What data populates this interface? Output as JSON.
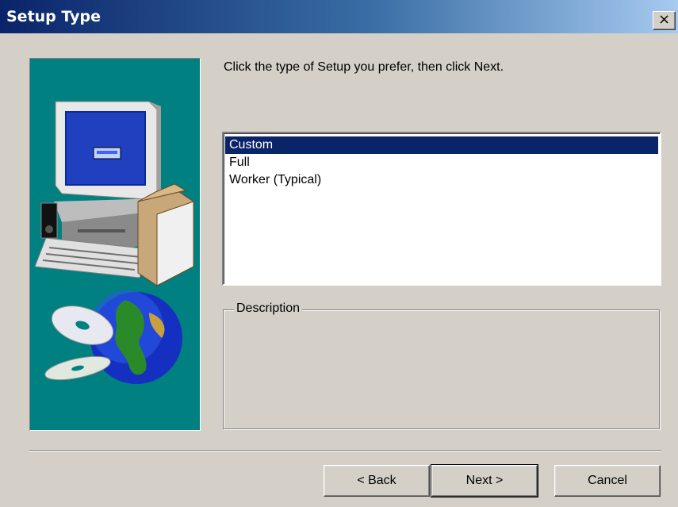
{
  "window": {
    "title": "Setup Type",
    "close_label": "×"
  },
  "prompt": "Click the type of Setup you prefer, then click Next.",
  "setup_types": [
    {
      "label": "Custom",
      "selected": true
    },
    {
      "label": "Full",
      "selected": false
    },
    {
      "label": "Worker (Typical)",
      "selected": false
    }
  ],
  "description": {
    "label": "Description",
    "text": ""
  },
  "buttons": {
    "back": "< Back",
    "next": "Next >",
    "cancel": "Cancel"
  }
}
